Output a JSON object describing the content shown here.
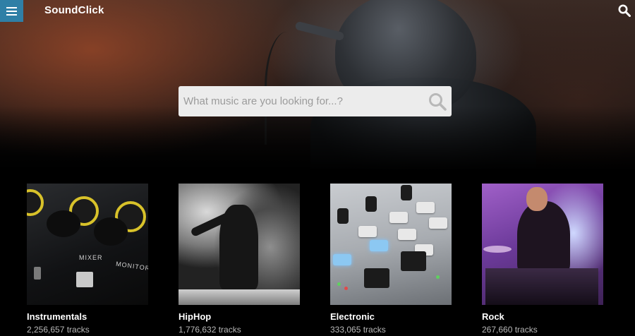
{
  "header": {
    "logo": "SoundClick",
    "menu_icon": "hamburger-menu-icon",
    "search_icon": "search-icon"
  },
  "search": {
    "placeholder": "What music are you looking for...?",
    "value": "",
    "submit_icon": "search-icon"
  },
  "colors": {
    "menu_button": "#2f7fa6",
    "background": "#000000",
    "search_box": "#ececec"
  },
  "genres": [
    {
      "name": "Instrumentals",
      "tracks": "2,256,657 tracks"
    },
    {
      "name": "HipHop",
      "tracks": "1,776,632 tracks"
    },
    {
      "name": "Electronic",
      "tracks": "333,065 tracks"
    },
    {
      "name": "Rock",
      "tracks": "267,660 tracks"
    }
  ]
}
